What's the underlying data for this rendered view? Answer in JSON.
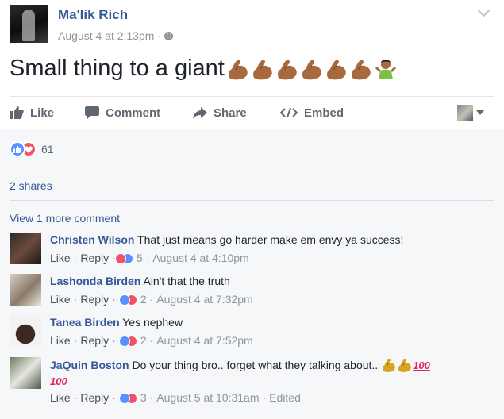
{
  "post": {
    "author": "Ma'lik Rich",
    "timestamp": "August 4 at 2:13pm",
    "dot": "·",
    "text": "Small thing to a giant",
    "emoji": [
      "flexed-biceps",
      "flexed-biceps",
      "flexed-biceps",
      "flexed-biceps",
      "flexed-biceps",
      "flexed-biceps",
      "man-gesturing-no"
    ]
  },
  "actions": {
    "like": "Like",
    "comment": "Comment",
    "share": "Share",
    "embed": "Embed"
  },
  "stats": {
    "reaction_count": "61",
    "shares": "2 shares",
    "view_more": "View 1 more comment"
  },
  "comments": [
    {
      "name": "Christen Wilson",
      "text": "That just means go harder make em envy ya success!",
      "like": "Like",
      "reply": "Reply",
      "reactions": "5",
      "time": "August 4 at 4:10pm",
      "edited": ""
    },
    {
      "name": "Lashonda Birden",
      "text": "Ain't that the truth",
      "like": "Like",
      "reply": "Reply",
      "reactions": "2",
      "time": "August 4 at 7:32pm",
      "edited": ""
    },
    {
      "name": "Tanea Birden",
      "text": "Yes nephew",
      "like": "Like",
      "reply": "Reply",
      "reactions": "2",
      "time": "August 4 at 7:52pm",
      "edited": ""
    },
    {
      "name": "JaQuin Boston",
      "text": "Do your thing bro.. forget what they talking about..",
      "hundred": "100",
      "like": "Like",
      "reply": "Reply",
      "reactions": "3",
      "time": "August 5 at 10:31am",
      "edited": "Edited"
    }
  ],
  "colors": {
    "link": "#365899",
    "muted": "#90949c",
    "like_blue": "#5890ff",
    "love_red": "#f25268",
    "flex": "#a86a3d"
  }
}
